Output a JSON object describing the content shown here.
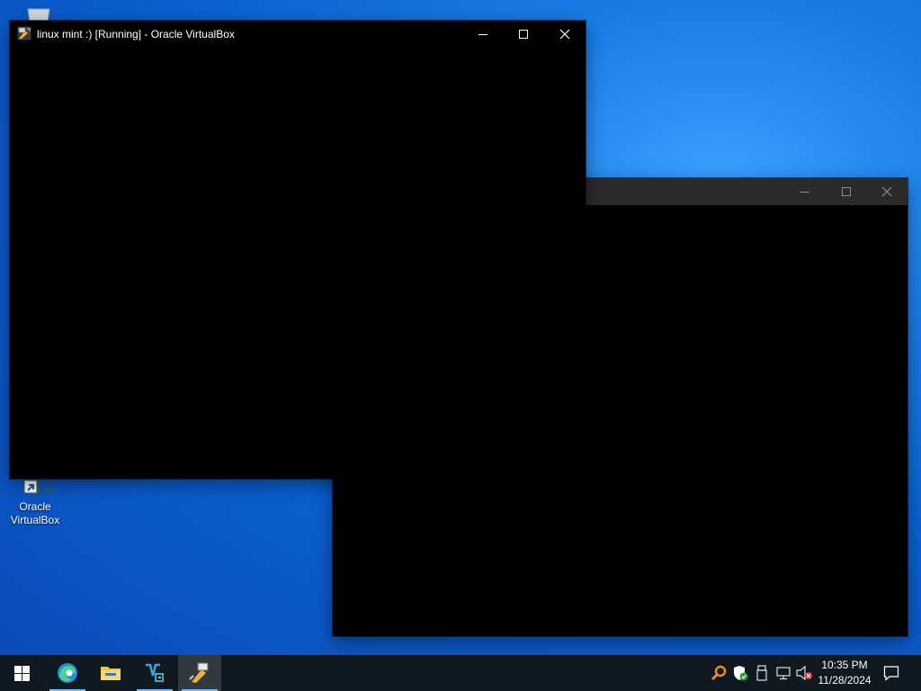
{
  "desktop": {
    "icons": [
      {
        "label_line1": "Oracle",
        "label_line2": "VirtualBox"
      }
    ]
  },
  "windows": {
    "front": {
      "title": "linux mint :) [Running] - Oracle VirtualBox",
      "state": "Running",
      "icon": "virtualbox-vm-icon"
    },
    "back": {
      "title": ""
    }
  },
  "taskbar": {
    "pinned": [
      {
        "name": "start",
        "icon": "windows-logo-icon"
      },
      {
        "name": "edge",
        "icon": "edge-icon"
      },
      {
        "name": "file-explorer",
        "icon": "folder-icon"
      },
      {
        "name": "virtualbox-manager",
        "icon": "virtualbox-icon"
      },
      {
        "name": "virtualbox-vm",
        "icon": "virtualbox-vm-icon",
        "active": true
      }
    ],
    "tray": {
      "icons": [
        "magnifier-icon",
        "security-shield-icon",
        "usb-device-icon",
        "network-icon",
        "volume-muted-icon"
      ],
      "time": "10:35 PM",
      "date": "11/28/2024"
    }
  },
  "colors": {
    "desktop_accent": "#0a63d4",
    "taskbar": "#101820",
    "front_window_titlebar": "#000000",
    "back_window_titlebar": "#2b2b2b",
    "active_underline": "#76b9ed"
  }
}
